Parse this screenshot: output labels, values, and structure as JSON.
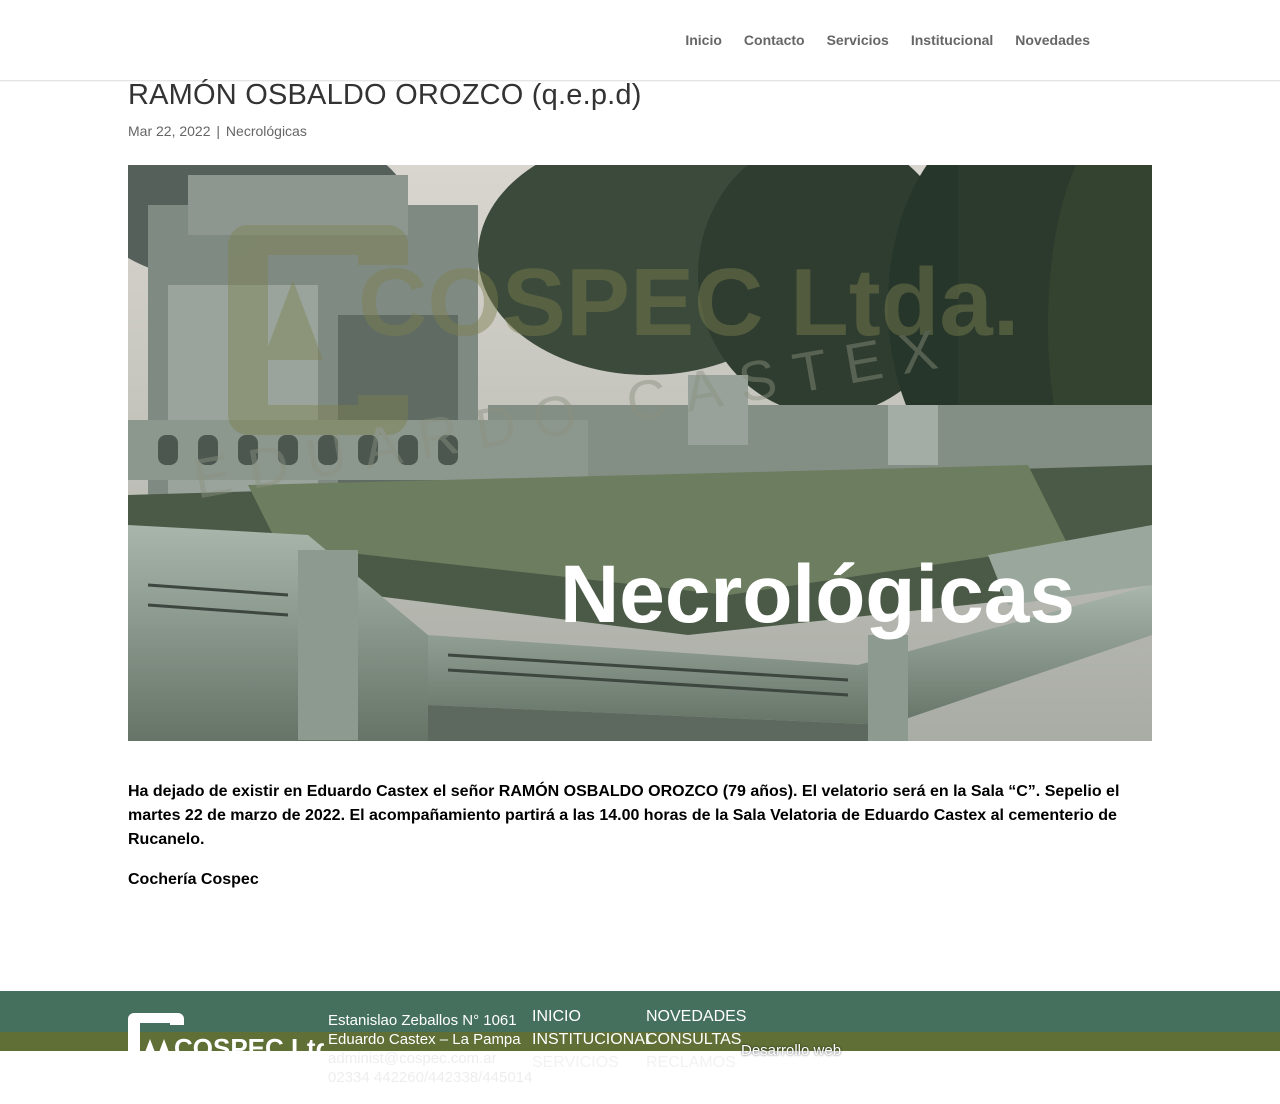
{
  "nav": {
    "items": [
      {
        "label": "Inicio"
      },
      {
        "label": "Contacto"
      },
      {
        "label": "Servicios"
      },
      {
        "label": "Institucional"
      },
      {
        "label": "Novedades"
      }
    ]
  },
  "post": {
    "title": "RAMÓN OSBALDO OROZCO (q.e.p.d)",
    "date": "Mar 22, 2022",
    "separator": "|",
    "category": "Necrológicas",
    "image": {
      "watermark_brand": "COSPEC Ltda.",
      "watermark_sub": "EDUARDO CASTEX",
      "overlay_text": "Necrológicas"
    },
    "paragraphs": [
      "Ha dejado  de existir en Eduardo Castex el señor RAMÓN OSBALDO OROZCO (79 años). El velatorio será en la  Sala “C”. Sepelio el martes 22 de marzo de 2022. El acompañamiento partirá a las 14.00 horas de la Sala Velatoria de Eduardo Castex  al cementerio de Rucanelo.",
      "Cochería Cospec"
    ]
  },
  "footer": {
    "logo_text": "COSPEC Ltda.",
    "address": {
      "street": "Estanislao Zeballos N° 1061",
      "city": "Eduardo Castex – La Pampa",
      "email": "administ@cospec.com.ar",
      "phones": "02334 442260/442338/445014"
    },
    "col1": [
      "INICIO",
      "INSTITUCIONAL",
      "SERVICIOS"
    ],
    "col2": [
      "NOVEDADES",
      "CONSULTAS",
      "RECLAMOS"
    ],
    "credit": "Desarrollo web"
  },
  "colors": {
    "footer_green": "#45705d",
    "footer_olive": "#5f6f35"
  }
}
